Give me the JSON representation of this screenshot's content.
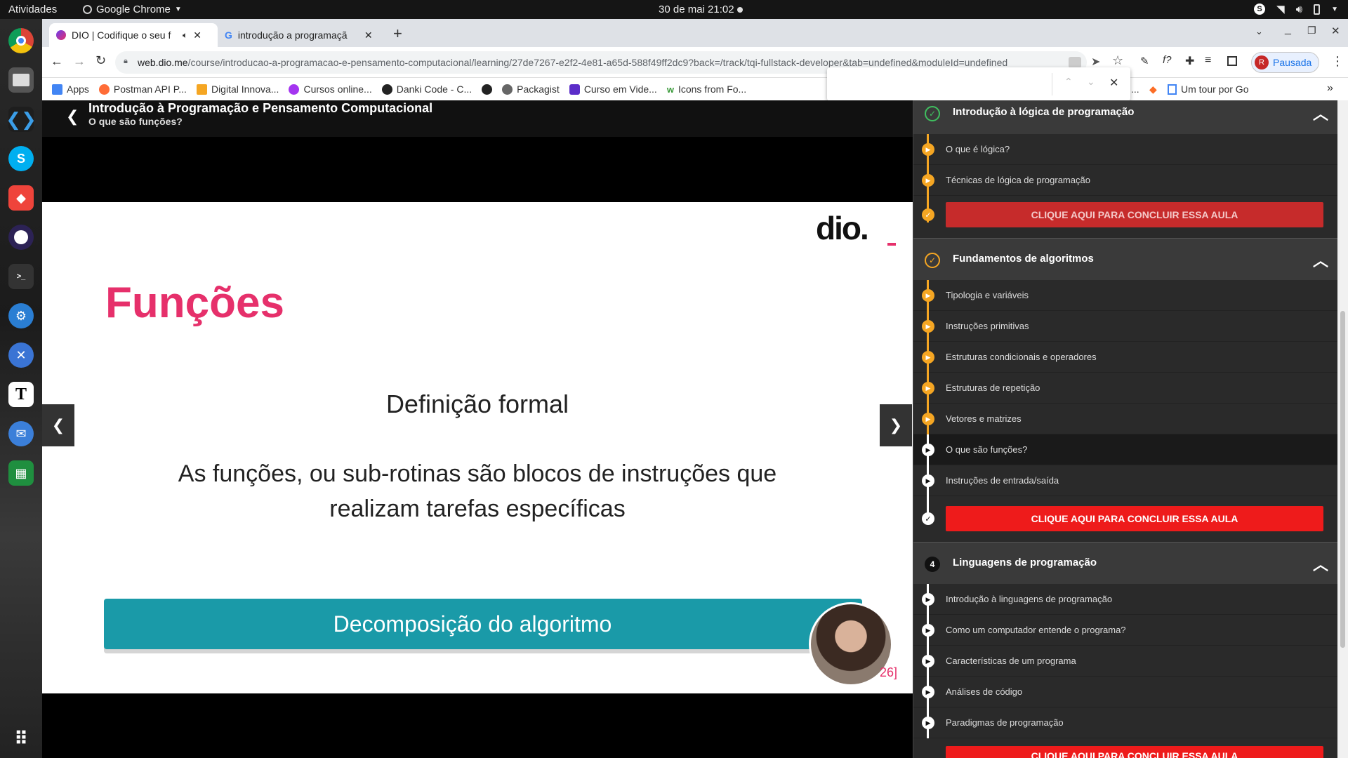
{
  "system": {
    "activities": "Atividades",
    "app_name": "Google Chrome",
    "clock": "30 de mai  21:02"
  },
  "browser": {
    "tabs": [
      {
        "label": "DIO | Codifique o seu f"
      },
      {
        "label": "introdução a programaçã"
      }
    ],
    "url_host": "web.dio.me",
    "url_path": "/course/introducao-a-programacao-e-pensamento-computacional/learning/27de7267-e2f2-4e81-a65d-588f49ff2dc9?back=/track/tqi-fullstack-developer&tab=undefined&moduleId=undefined",
    "profile_label": "Pausada",
    "profile_initial": "R",
    "bookmarks": [
      {
        "label": "Apps",
        "color": "#4285f4"
      },
      {
        "label": "Postman API P...",
        "color": "#ff6c37"
      },
      {
        "label": "Digital Innova...",
        "color": "#f5a623"
      },
      {
        "label": "Cursos online...",
        "color": "#a435f0"
      },
      {
        "label": "Danki Code - C...",
        "color": "#222222"
      },
      {
        "label": "",
        "color": "#222222"
      },
      {
        "label": "Packagist",
        "color": "#666666"
      },
      {
        "label": "Curso em Vide...",
        "color": "#5b2dc9"
      },
      {
        "label": "Icons from Fo...",
        "color": "#3a9a3a"
      }
    ],
    "bookmark_right": "Um tour por Go",
    "bookmark_ellipsis": "..."
  },
  "course": {
    "title": "Introdução à Programação e Pensamento Computacional",
    "lesson": "O que são funções?"
  },
  "slide": {
    "logo": "dio.",
    "heading": "Funções",
    "subtitle": "Definição formal",
    "body_line1": "As funções, ou sub-rotinas são blocos de instruções que",
    "body_line2": "realizam tarefas específicas",
    "banner": "Decomposição do algoritmo",
    "page_num": "26]"
  },
  "sidebar": {
    "modules": [
      {
        "title": "Introdução à lógica de programação",
        "status": "done",
        "lessons": [
          "O que é lógica?",
          "Técnicas de lógica de programação"
        ],
        "cta": "CLIQUE AQUI PARA CONCLUIR ESSA AULA"
      },
      {
        "title": "Fundamentos de algoritmos",
        "status": "in-progress",
        "lessons": [
          "Tipologia e variáveis",
          "Instruções primitivas",
          "Estruturas condicionais e operadores",
          "Estruturas de repetição",
          "Vetores e matrizes",
          "O que são funções?",
          "Instruções de entrada/saída"
        ],
        "cta": "CLIQUE AQUI PARA CONCLUIR ESSA AULA"
      },
      {
        "title": "Linguagens de programação",
        "number": "4",
        "lessons": [
          "Introdução à linguagens de programação",
          "Como um computador entende o programa?",
          "Características de um programa",
          "Análises de código",
          "Paradigmas de programação"
        ],
        "cta": "CLIQUE AQUI PARA CONCLUIR ESSA AULA"
      }
    ]
  },
  "colors": {
    "accent_orange": "#f5a623",
    "done_green": "#3fbf5f",
    "cta_dark_red": "#c62b2b",
    "cta_red": "#ee1b1b",
    "slide_pink": "#e6306b",
    "banner_teal": "#1a9aa8"
  }
}
